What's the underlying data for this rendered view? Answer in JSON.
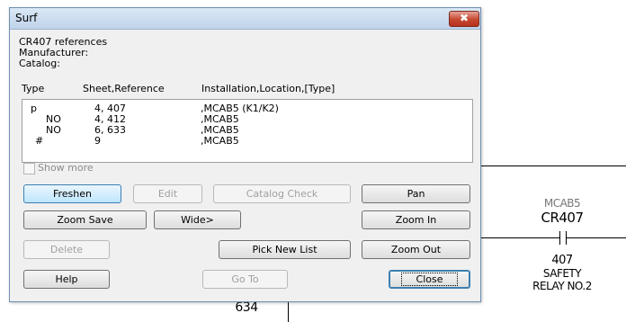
{
  "window": {
    "title": "Surf",
    "close_symbol": "✖"
  },
  "info": {
    "line1": "CR407 references",
    "line2": "Manufacturer:",
    "line3": "Catalog:"
  },
  "columns": {
    "type": "Type",
    "sheet": "Sheet,Reference",
    "install": "Installation,Location,[Type]"
  },
  "rows": [
    {
      "type": "p",
      "sheet": "4, 407",
      "install": ",MCAB5 (K1/K2)"
    },
    {
      "type": "NO",
      "sheet": "4, 412",
      "install": ",MCAB5"
    },
    {
      "type": "NO",
      "sheet": "6, 633",
      "install": ",MCAB5"
    },
    {
      "type": "#",
      "sheet": "9",
      "install": ",MCAB5"
    }
  ],
  "show_more": {
    "label": "Show more",
    "checked": false
  },
  "buttons": {
    "freshen": "Freshen",
    "edit": "Edit",
    "catalog_check": "Catalog Check",
    "pan": "Pan",
    "zoom_save": "Zoom Save",
    "wide": "Wide>",
    "zoom_in": "Zoom In",
    "delete": "Delete",
    "pick_new_list": "Pick New List",
    "zoom_out": "Zoom Out",
    "help": "Help",
    "go_to": "Go To",
    "close": "Close"
  },
  "schematic": {
    "location": "MCAB5",
    "tag": "CR407",
    "ref": "407",
    "desc1": "SAFETY",
    "desc2": "RELAY NO.2",
    "wire_number": "634"
  }
}
